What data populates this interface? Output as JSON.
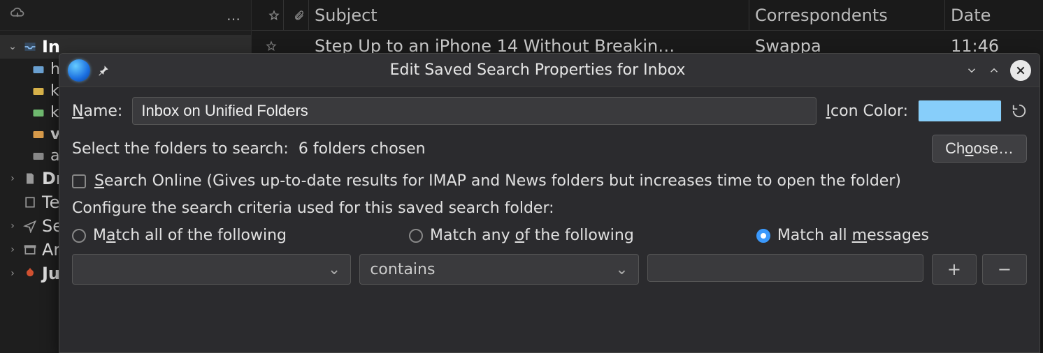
{
  "sidebar": {
    "items": [
      {
        "label": "In",
        "selected": true
      },
      {
        "label": "h"
      },
      {
        "label": "k"
      },
      {
        "label": "k"
      },
      {
        "label": "v"
      },
      {
        "label": "a"
      },
      {
        "label": "Dr",
        "top": true
      },
      {
        "label": "Te"
      },
      {
        "label": "Se",
        "top": true
      },
      {
        "label": "Ar",
        "top": true
      },
      {
        "label": "Ju",
        "top": true,
        "bold": true
      }
    ]
  },
  "columns": {
    "subject": "Subject",
    "correspondents": "Correspondents",
    "date": "Date"
  },
  "messages": [
    {
      "subject": "Step Up to an iPhone 14 Without Breakin…",
      "from": "Swappa",
      "date": "11:46"
    }
  ],
  "dialog": {
    "title": "Edit Saved Search Properties for Inbox",
    "name_label_pre": "N",
    "name_label_rest": "ame:",
    "name_value": "Inbox on Unified Folders",
    "icon_color_pre": "I",
    "icon_color_rest": "con Color:",
    "icon_color_value": "#87cefa",
    "folders_label": "Select the folders to search:",
    "folders_chosen": "6 folders chosen",
    "choose_pre": "Ch",
    "choose_ul": "o",
    "choose_rest": "ose…",
    "search_online_pre": "S",
    "search_online_rest": "earch Online (Gives up-to-date results for IMAP and News folders but increases time to open the folder)",
    "search_online_checked": false,
    "configure_label": "Configure the search criteria used for this saved search folder:",
    "match_all_pre": "M",
    "match_all_ul": "a",
    "match_all_rest": "tch all of the following",
    "match_any_pre": "Match any ",
    "match_any_ul": "o",
    "match_any_rest": "f the following",
    "match_msgs_pre": "Match all ",
    "match_msgs_ul": "m",
    "match_msgs_rest": "essages",
    "match_selected": "messages",
    "criteria": {
      "field": "",
      "op": "contains",
      "value": ""
    }
  }
}
